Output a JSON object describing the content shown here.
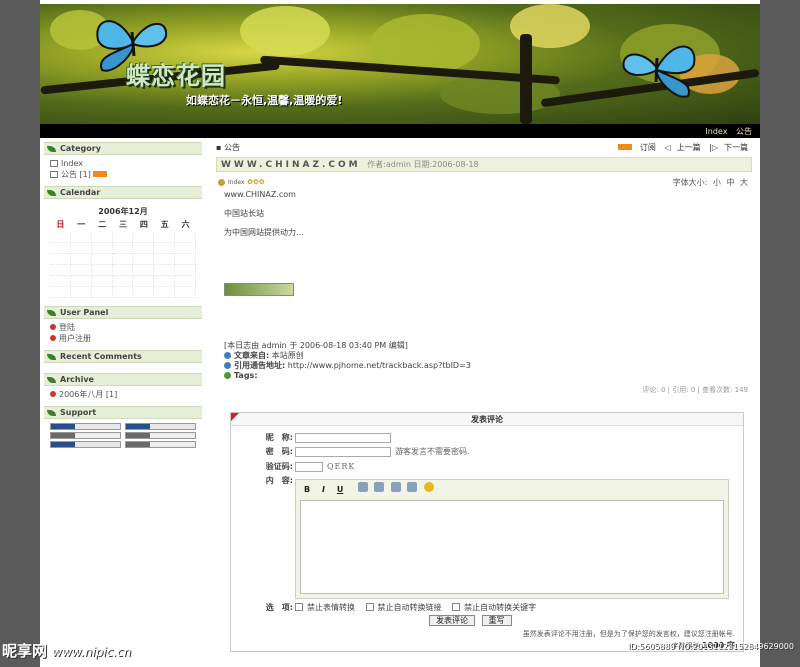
{
  "banner": {
    "title": "蝶恋花园",
    "slogan": "如蝶恋花－永恒,温馨,温暖的爱!"
  },
  "nav": {
    "links": [
      "Index",
      "公告"
    ]
  },
  "sidebar": {
    "category": {
      "heading": "Category",
      "items": [
        {
          "label": "Index"
        },
        {
          "label": "公告 [1]"
        }
      ]
    },
    "calendar": {
      "heading": "Calendar",
      "month": "2006年12月",
      "weekdays": [
        "日",
        "一",
        "二",
        "三",
        "四",
        "五",
        "六"
      ]
    },
    "user_panel": {
      "heading": "User Panel",
      "items": [
        "登陆",
        "用户注册"
      ]
    },
    "recent_comments": {
      "heading": "Recent Comments"
    },
    "archive": {
      "heading": "Archive",
      "items": [
        "2006年八月 [1]"
      ]
    },
    "support": {
      "heading": "Support"
    }
  },
  "post": {
    "category_label": "公告",
    "nav_links": [
      "订阅",
      "上一篇",
      "下一篇"
    ],
    "title": "WWW.CHINAZ.COM",
    "meta": "作者:admin 日期:2006-08-18",
    "author_tag": "Index",
    "font_size": {
      "label": "字体大小:",
      "options": [
        "小",
        "中",
        "大"
      ]
    },
    "lines": [
      "www.CHINAZ.com",
      "中国站长站",
      "为中国网站提供动力..."
    ],
    "edit_note": "[本日志由 admin 于 2006-08-18 03:40 PM 编辑]",
    "source_label": "文章来自:",
    "source_value": "本站原创",
    "trackback_label": "引用通告地址:",
    "trackback_value": "http://www.pjhome.net/trackback.asp?tbID=3",
    "tags_label": "Tags:",
    "stats": "评论: 0 | 引用: 0 | 查看次数: 149"
  },
  "comment_form": {
    "title": "发表评论",
    "name_label": "昵　称:",
    "password_label": "密　码:",
    "password_hint": "游客发言不需要密码.",
    "code_label": "验证码:",
    "code_value": "QERK",
    "content_label": "内　容:",
    "toolbar": [
      "B",
      "I",
      "U"
    ],
    "options_label": "选　项:",
    "options": [
      "禁止表情转换",
      "禁止自动转换链接",
      "禁止自动转换关键字"
    ],
    "submit_label": "发表评论",
    "reset_label": "重写",
    "note": "虽然发表评论不用注册，但是为了保护您的发言权，建议您注册帐号.",
    "limit_label": "字数限制",
    "limit_value": "1000 字"
  },
  "watermark": {
    "site": "昵享网",
    "url": "www.nipic.cn",
    "id": "ID:5605889 NO:20131123152849629000"
  }
}
